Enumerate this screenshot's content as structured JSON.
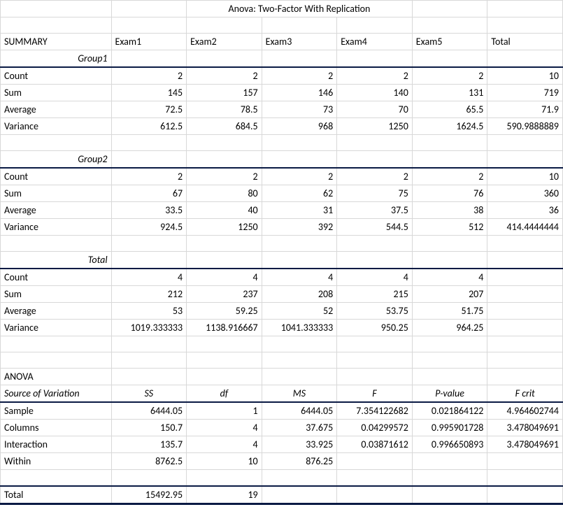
{
  "title": "Anova: Two-Factor With Replication",
  "summary_label": "SUMMARY",
  "headers": {
    "e1": "Exam1",
    "e2": "Exam2",
    "e3": "Exam3",
    "e4": "Exam4",
    "e5": "Exam5",
    "total": "Total"
  },
  "row_labels": {
    "count": "Count",
    "sum": "Sum",
    "average": "Average",
    "variance": "Variance"
  },
  "group1": {
    "label": "Group1",
    "count": {
      "e1": "2",
      "e2": "2",
      "e3": "2",
      "e4": "2",
      "e5": "2",
      "total": "10"
    },
    "sum": {
      "e1": "145",
      "e2": "157",
      "e3": "146",
      "e4": "140",
      "e5": "131",
      "total": "719"
    },
    "average": {
      "e1": "72.5",
      "e2": "78.5",
      "e3": "73",
      "e4": "70",
      "e5": "65.5",
      "total": "71.9"
    },
    "variance": {
      "e1": "612.5",
      "e2": "684.5",
      "e3": "968",
      "e4": "1250",
      "e5": "1624.5",
      "total": "590.9888889"
    }
  },
  "group2": {
    "label": "Group2",
    "count": {
      "e1": "2",
      "e2": "2",
      "e3": "2",
      "e4": "2",
      "e5": "2",
      "total": "10"
    },
    "sum": {
      "e1": "67",
      "e2": "80",
      "e3": "62",
      "e4": "75",
      "e5": "76",
      "total": "360"
    },
    "average": {
      "e1": "33.5",
      "e2": "40",
      "e3": "31",
      "e4": "37.5",
      "e5": "38",
      "total": "36"
    },
    "variance": {
      "e1": "924.5",
      "e2": "1250",
      "e3": "392",
      "e4": "544.5",
      "e5": "512",
      "total": "414.4444444"
    }
  },
  "totals": {
    "label": "Total",
    "count": {
      "e1": "4",
      "e2": "4",
      "e3": "4",
      "e4": "4",
      "e5": "4",
      "total": ""
    },
    "sum": {
      "e1": "212",
      "e2": "237",
      "e3": "208",
      "e4": "215",
      "e5": "207",
      "total": ""
    },
    "average": {
      "e1": "53",
      "e2": "59.25",
      "e3": "52",
      "e4": "53.75",
      "e5": "51.75",
      "total": ""
    },
    "variance": {
      "e1": "1019.333333",
      "e2": "1138.916667",
      "e3": "1041.333333",
      "e4": "950.25",
      "e5": "964.25",
      "total": ""
    }
  },
  "anova": {
    "label": "ANOVA",
    "cols": {
      "src": "Source of Variation",
      "ss": "SS",
      "df": "df",
      "ms": "MS",
      "f": "F",
      "p": "P-value",
      "fcrit": "F crit"
    },
    "rows": {
      "sample": {
        "label": "Sample",
        "ss": "6444.05",
        "df": "1",
        "ms": "6444.05",
        "f": "7.354122682",
        "p": "0.021864122",
        "fcrit": "4.964602744"
      },
      "columns": {
        "label": "Columns",
        "ss": "150.7",
        "df": "4",
        "ms": "37.675",
        "f": "0.04299572",
        "p": "0.995901728",
        "fcrit": "3.478049691"
      },
      "interaction": {
        "label": "Interaction",
        "ss": "135.7",
        "df": "4",
        "ms": "33.925",
        "f": "0.03871612",
        "p": "0.996650893",
        "fcrit": "3.478049691"
      },
      "within": {
        "label": "Within",
        "ss": "8762.5",
        "df": "10",
        "ms": "876.25",
        "f": "",
        "p": "",
        "fcrit": ""
      },
      "total": {
        "label": "Total",
        "ss": "15492.95",
        "df": "19",
        "ms": "",
        "f": "",
        "p": "",
        "fcrit": ""
      }
    }
  }
}
